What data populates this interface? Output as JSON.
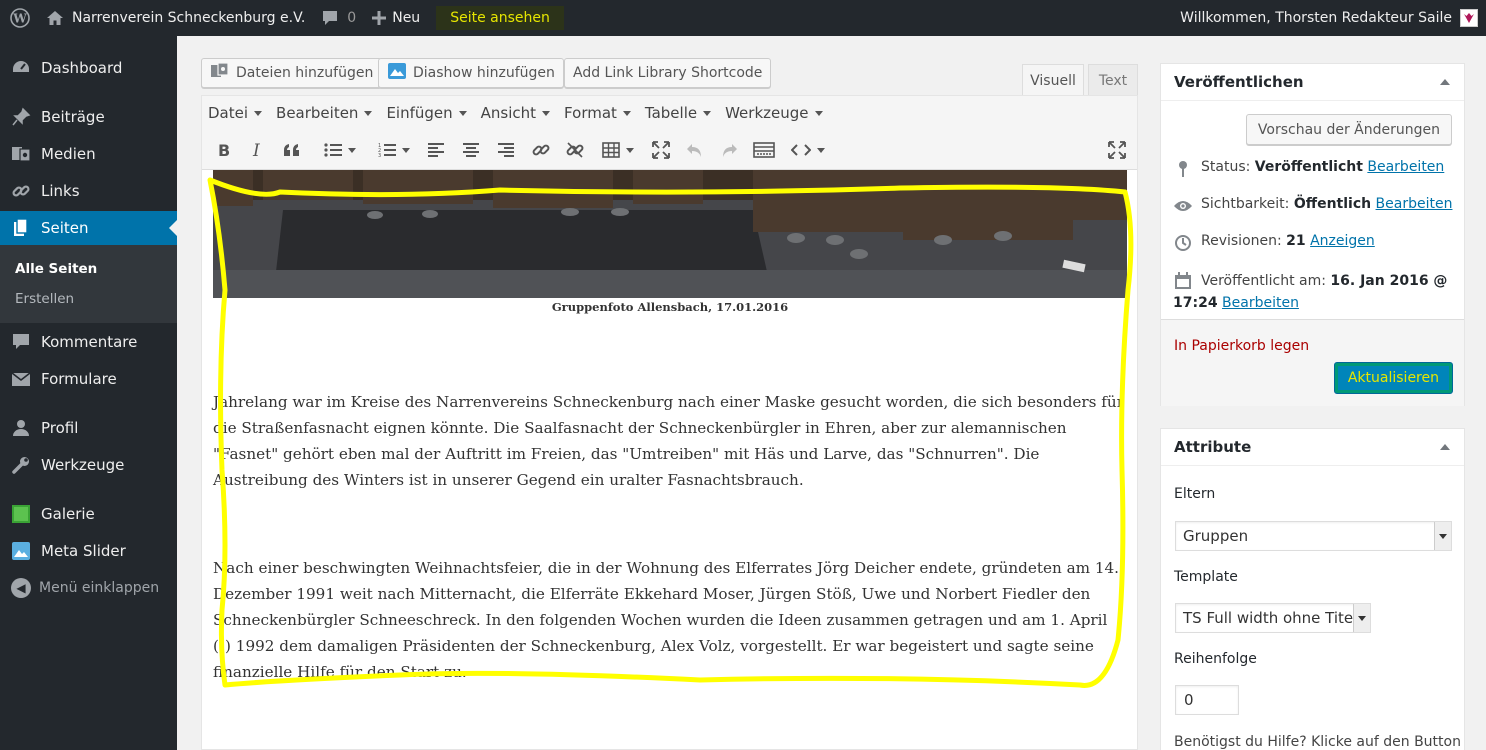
{
  "admin_bar": {
    "site_name": "Narrenverein Schneckenburg e.V.",
    "comments_count": "0",
    "new_label": "Neu",
    "view_page_label": "Seite ansehen",
    "account_label": "Willkommen, Thorsten Redakteur Saile"
  },
  "sidebar": {
    "items": [
      {
        "label": "Dashboard",
        "icon": "dashboard-icon"
      },
      {
        "label": "Beiträge",
        "icon": "pin-icon"
      },
      {
        "label": "Medien",
        "icon": "media-icon"
      },
      {
        "label": "Links",
        "icon": "links-icon"
      },
      {
        "label": "Seiten",
        "icon": "pages-icon"
      },
      {
        "label": "Kommentare",
        "icon": "comments-icon"
      },
      {
        "label": "Formulare",
        "icon": "forms-icon"
      },
      {
        "label": "Profil",
        "icon": "profile-icon"
      },
      {
        "label": "Werkzeuge",
        "icon": "tools-icon"
      },
      {
        "label": "Galerie",
        "icon": "gallery-icon"
      },
      {
        "label": "Meta Slider",
        "icon": "slider-icon"
      }
    ],
    "submenu": [
      "Alle Seiten",
      "Erstellen"
    ],
    "collapse_label": "Menü einklappen"
  },
  "editor": {
    "media_buttons": [
      "Dateien hinzufügen",
      "Diashow hinzufügen",
      "Add Link Library Shortcode"
    ],
    "tabs": {
      "visual": "Visuell",
      "text": "Text"
    },
    "menubar": [
      "Datei",
      "Bearbeiten",
      "Einfügen",
      "Ansicht",
      "Format",
      "Tabelle",
      "Werkzeuge"
    ],
    "caption": "Gruppenfoto Allensbach, 17.01.2016",
    "paragraphs": [
      "Jahrelang war im Kreise des Narrenvereins Schneckenburg nach einer Maske gesucht worden, die sich besonders für die Straßenfasnacht eignen könnte. Die Saalfasnacht der Schneckenbürgler in Ehren, aber zur alemannischen \"Fasnet\" gehört eben mal der Auftritt im Freien, das \"Umtreiben\" mit Häs und Larve, das \"Schnurren\". Die Austreibung des Winters ist in unserer Gegend ein uralter Fasnachtsbrauch.",
      "Nach einer beschwingten Weihnachtsfeier, die in der Wohnung des Elferrates Jörg Deicher endete, gründeten am 14. Dezember 1991 weit nach Mitternacht, die Elferräte Ekkehard Moser, Jürgen Stöß, Uwe und Norbert Fiedler den Schneckenbürgler Schneeschreck.  In den folgenden Wochen wurden die Ideen zusammen getragen und am 1. April (!) 1992 dem damaligen Präsidenten der Schneckenburg, Alex Volz, vorgestellt. Er war begeistert und sagte seine finanzielle Hilfe für den Start zu."
    ]
  },
  "publish": {
    "title": "Veröffentlichen",
    "preview_label": "Vorschau der Änderungen",
    "status_label": "Status:",
    "status_value": "Veröffentlicht",
    "visibility_label": "Sichtbarkeit:",
    "visibility_value": "Öffentlich",
    "revisions_label": "Revisionen:",
    "revisions_value": "21",
    "revisions_link": "Anzeigen",
    "published_label": "Veröffentlicht am:",
    "published_value": "16. Jan 2016 @",
    "published_time": "17:24",
    "edit_link": "Bearbeiten",
    "trash_label": "In Papierkorb legen",
    "update_label": "Aktualisieren"
  },
  "attributes": {
    "title": "Attribute",
    "parent_label": "Eltern",
    "parent_value": "Gruppen",
    "template_label": "Template",
    "template_value": "TS Full width ohne Titel",
    "order_label": "Reihenfolge",
    "order_value": "0",
    "help_text": "Benötigst du Hilfe? Klicke auf den Button"
  },
  "colors": {
    "adminbar": "#23282d",
    "active_menu": "#0073aa",
    "highlight": "#ffff00",
    "link": "#0073aa",
    "trash": "#aa0000"
  }
}
